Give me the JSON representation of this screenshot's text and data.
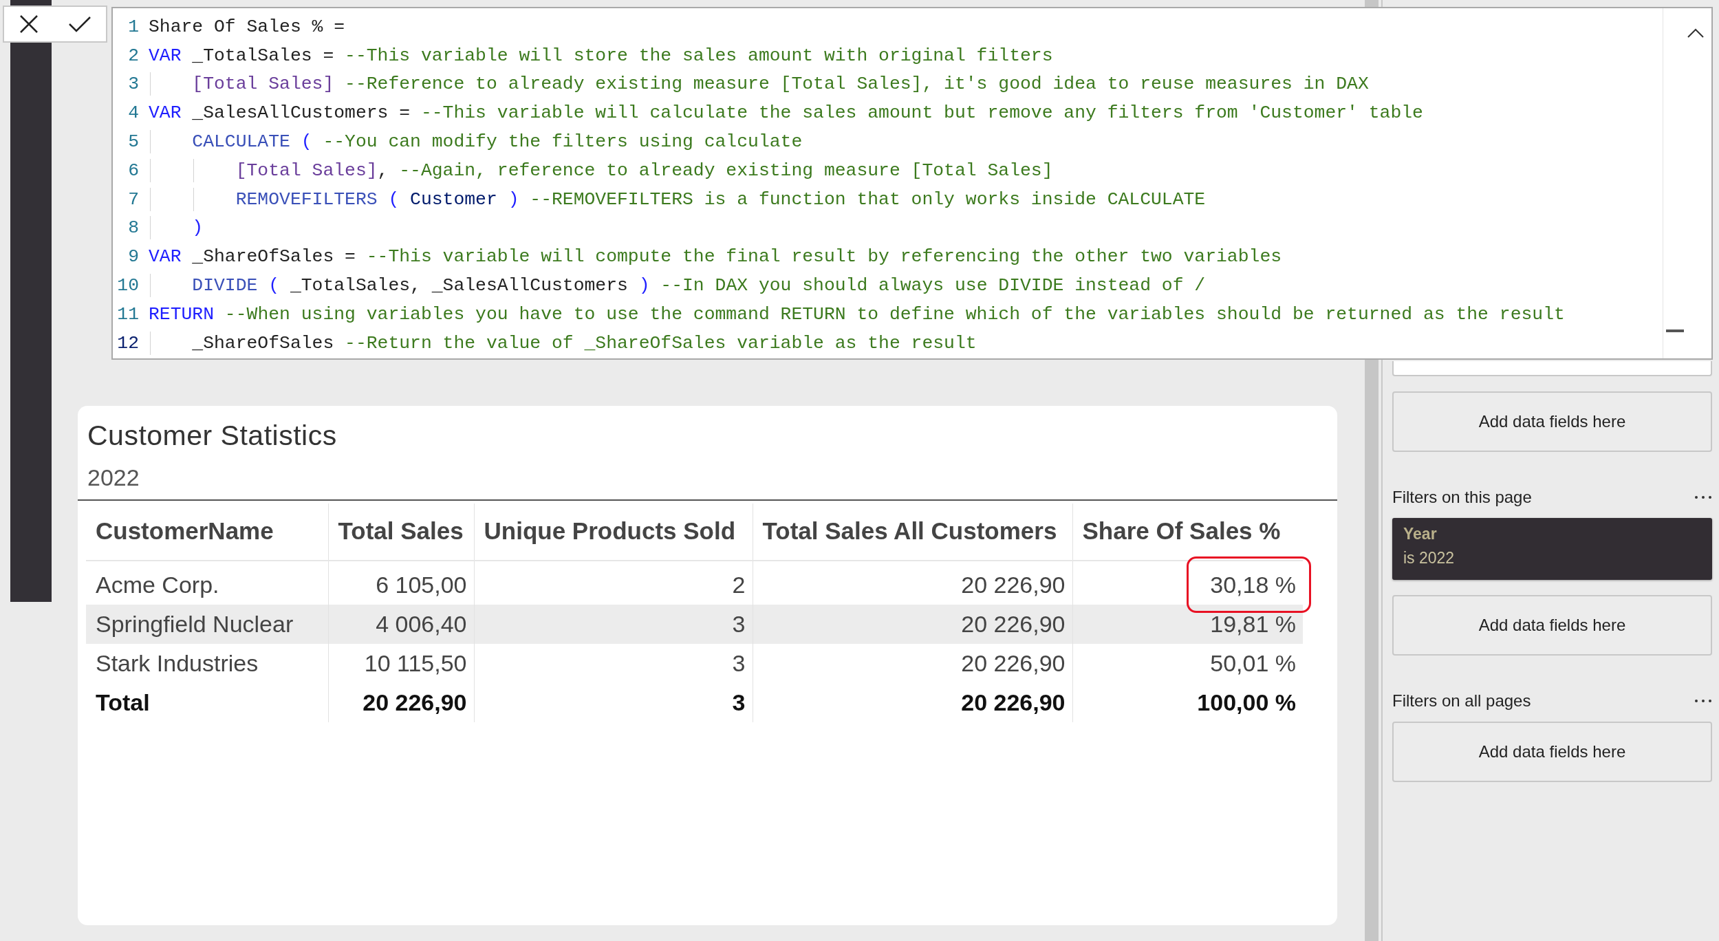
{
  "formula_bar": {
    "code_lines": [
      {
        "number": "1",
        "current": false,
        "tokens": [
          {
            "kind": "plain",
            "text": "Share Of Sales % ="
          }
        ]
      },
      {
        "number": "2",
        "current": false,
        "tokens": [
          {
            "kind": "keyword",
            "text": "VAR"
          },
          {
            "kind": "plain",
            "text": " _TotalSales = "
          },
          {
            "kind": "comment",
            "text": "--This variable will store the sales amount with original filters"
          }
        ]
      },
      {
        "number": "3",
        "current": false,
        "tokens": [
          {
            "kind": "measure",
            "text": "    [Total Sales]"
          },
          {
            "kind": "comment",
            "text": " --Reference to already existing measure [Total Sales], it's good idea to reuse measures in DAX"
          }
        ]
      },
      {
        "number": "4",
        "current": false,
        "tokens": [
          {
            "kind": "keyword",
            "text": "VAR"
          },
          {
            "kind": "plain",
            "text": " _SalesAllCustomers = "
          },
          {
            "kind": "comment",
            "text": "--This variable will calculate the sales amount but remove any filters from 'Customer' table"
          }
        ]
      },
      {
        "number": "5",
        "current": false,
        "tokens": [
          {
            "kind": "function",
            "text": "    CALCULATE"
          },
          {
            "kind": "paren",
            "text": " ( "
          },
          {
            "kind": "comment",
            "text": "--You can modify the filters using calculate"
          }
        ]
      },
      {
        "number": "6",
        "current": false,
        "tokens": [
          {
            "kind": "measure",
            "text": "        [Total Sales]"
          },
          {
            "kind": "plain",
            "text": ", "
          },
          {
            "kind": "comment",
            "text": "--Again, reference to already existing measure [Total Sales]"
          }
        ]
      },
      {
        "number": "7",
        "current": false,
        "tokens": [
          {
            "kind": "function",
            "text": "        REMOVEFILTERS"
          },
          {
            "kind": "paren",
            "text": " ( "
          },
          {
            "kind": "table",
            "text": "Customer"
          },
          {
            "kind": "paren",
            "text": " ) "
          },
          {
            "kind": "comment",
            "text": "--REMOVEFILTERS is a function that only works inside CALCULATE"
          }
        ]
      },
      {
        "number": "8",
        "current": false,
        "tokens": [
          {
            "kind": "paren",
            "text": "    )"
          }
        ]
      },
      {
        "number": "9",
        "current": false,
        "tokens": [
          {
            "kind": "keyword",
            "text": "VAR"
          },
          {
            "kind": "plain",
            "text": " _ShareOfSales = "
          },
          {
            "kind": "comment",
            "text": "--This variable will compute the final result by referencing the other two variables"
          }
        ]
      },
      {
        "number": "10",
        "current": false,
        "tokens": [
          {
            "kind": "function",
            "text": "    DIVIDE"
          },
          {
            "kind": "paren",
            "text": " ( "
          },
          {
            "kind": "plain",
            "text": "_TotalSales, _SalesAllCustomers"
          },
          {
            "kind": "paren",
            "text": " ) "
          },
          {
            "kind": "comment",
            "text": "--In DAX you should always use DIVIDE instead of /"
          }
        ]
      },
      {
        "number": "11",
        "current": false,
        "tokens": [
          {
            "kind": "keyword",
            "text": "RETURN"
          },
          {
            "kind": "comment",
            "text": " --When using variables you have to use the command RETURN to define which of the variables should be returned as the result"
          }
        ]
      },
      {
        "number": "12",
        "current": true,
        "tokens": [
          {
            "kind": "plain",
            "text": "    _ShareOfSales "
          },
          {
            "kind": "comment",
            "text": "--Return the value of _ShareOfSales variable as the result"
          }
        ]
      }
    ]
  },
  "visual": {
    "title": "Customer Statistics",
    "subtitle": "2022",
    "table": {
      "columns": [
        "CustomerName",
        "Total Sales",
        "Unique Products Sold",
        "Total Sales All Customers",
        "Share Of Sales %"
      ],
      "rows": [
        {
          "cells": [
            "Acme Corp.",
            "6 105,00",
            "2",
            "20 226,90",
            "30,18 %"
          ],
          "highlighted": true,
          "total": false
        },
        {
          "cells": [
            "Springfield Nuclear",
            "4 006,40",
            "3",
            "20 226,90",
            "19,81 %"
          ],
          "highlighted": false,
          "total": false
        },
        {
          "cells": [
            "Stark Industries",
            "10 115,50",
            "3",
            "20 226,90",
            "50,01 %"
          ],
          "highlighted": false,
          "total": false
        },
        {
          "cells": [
            "Total",
            "20 226,90",
            "3",
            "20 226,90",
            "100,00 %"
          ],
          "highlighted": false,
          "total": true
        }
      ]
    }
  },
  "filters_pane": {
    "sections": [
      {
        "cards": [
          {
            "kind": "hidden"
          },
          {
            "kind": "empty",
            "label": "Add data fields here"
          }
        ]
      },
      {
        "heading": "Filters on this page",
        "cards": [
          {
            "kind": "filter",
            "field": "Year",
            "value": "is 2022"
          },
          {
            "kind": "empty",
            "label": "Add data fields here"
          }
        ]
      },
      {
        "heading": "Filters on all pages",
        "cards": [
          {
            "kind": "empty",
            "label": "Add data fields here"
          }
        ]
      }
    ]
  }
}
